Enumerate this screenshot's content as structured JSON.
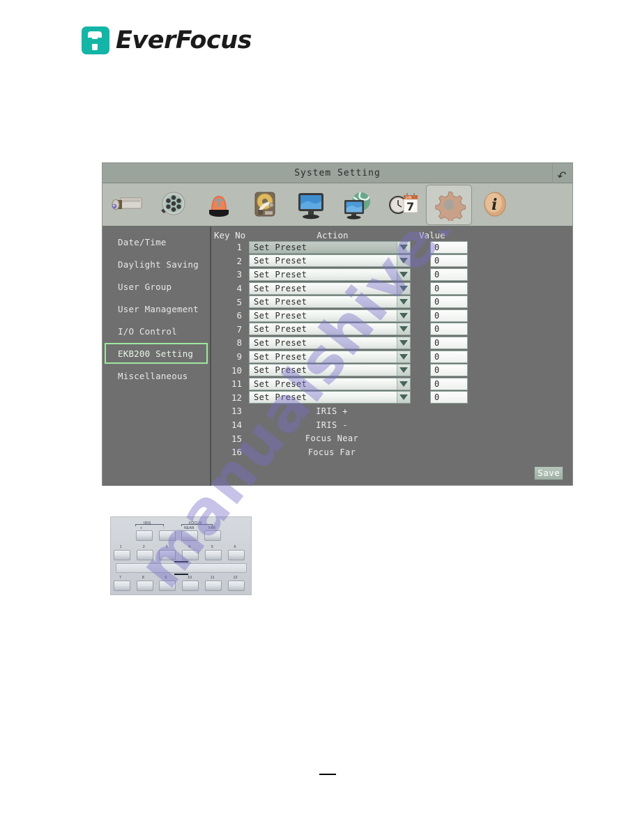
{
  "logo": {
    "brand": "EverFocus"
  },
  "watermark": {
    "text": "manualshive.com"
  },
  "osd": {
    "title": "System Setting",
    "back_icon": "back-arrow-icon",
    "toolbar": [
      {
        "name": "camera",
        "label": "Camera",
        "selected": false
      },
      {
        "name": "record",
        "label": "Record",
        "selected": false
      },
      {
        "name": "alarm",
        "label": "Alarm",
        "selected": false
      },
      {
        "name": "disk",
        "label": "Disk",
        "selected": false
      },
      {
        "name": "display",
        "label": "Display",
        "selected": false
      },
      {
        "name": "network",
        "label": "Network",
        "selected": false
      },
      {
        "name": "schedule",
        "label": "Schedule",
        "selected": false
      },
      {
        "name": "system",
        "label": "System",
        "selected": true
      },
      {
        "name": "information",
        "label": "Information",
        "selected": false
      }
    ],
    "sidebar": [
      {
        "label": "Date/Time",
        "selected": false
      },
      {
        "label": "Daylight Saving",
        "selected": false
      },
      {
        "label": "User Group",
        "selected": false
      },
      {
        "label": "User Management",
        "selected": false
      },
      {
        "label": "I/O Control",
        "selected": false
      },
      {
        "label": "EKB200 Setting",
        "selected": true
      },
      {
        "label": "Miscellaneous",
        "selected": false
      }
    ],
    "table": {
      "headers": {
        "key_no": "Key No",
        "action": "Action",
        "value": "Value"
      },
      "rows": [
        {
          "key": "1",
          "action": "Set Preset",
          "value": "0",
          "editable": true,
          "active": true
        },
        {
          "key": "2",
          "action": "Set Preset",
          "value": "0",
          "editable": true,
          "active": false
        },
        {
          "key": "3",
          "action": "Set Preset",
          "value": "0",
          "editable": true,
          "active": false
        },
        {
          "key": "4",
          "action": "Set Preset",
          "value": "0",
          "editable": true,
          "active": false
        },
        {
          "key": "5",
          "action": "Set Preset",
          "value": "0",
          "editable": true,
          "active": false
        },
        {
          "key": "6",
          "action": "Set Preset",
          "value": "0",
          "editable": true,
          "active": false
        },
        {
          "key": "7",
          "action": "Set Preset",
          "value": "0",
          "editable": true,
          "active": false
        },
        {
          "key": "8",
          "action": "Set Preset",
          "value": "0",
          "editable": true,
          "active": false
        },
        {
          "key": "9",
          "action": "Set Preset",
          "value": "0",
          "editable": true,
          "active": false
        },
        {
          "key": "10",
          "action": "Set Preset",
          "value": "0",
          "editable": true,
          "active": false
        },
        {
          "key": "11",
          "action": "Set Preset",
          "value": "0",
          "editable": true,
          "active": false
        },
        {
          "key": "12",
          "action": "Set Preset",
          "value": "0",
          "editable": true,
          "active": false
        },
        {
          "key": "13",
          "action": "IRIS +",
          "value": "",
          "editable": false,
          "active": false
        },
        {
          "key": "14",
          "action": "IRIS -",
          "value": "",
          "editable": false,
          "active": false
        },
        {
          "key": "15",
          "action": "Focus Near",
          "value": "",
          "editable": false,
          "active": false
        },
        {
          "key": "16",
          "action": "Focus Far",
          "value": "",
          "editable": false,
          "active": false
        }
      ]
    },
    "save_label": "Save"
  },
  "keypad": {
    "group_iris": "IRIS",
    "group_focus": "FOCUS",
    "iris_plus": "+",
    "iris_minus": "-",
    "focus_near": "NEAR",
    "focus_far": "FAR",
    "numbers_top": [
      "1",
      "2",
      "3",
      "4",
      "5",
      "6"
    ],
    "numbers_bottom": [
      "7",
      "8",
      "9",
      "10",
      "11",
      "12"
    ]
  },
  "colors": {
    "panel_bg": "#6f6f6f",
    "titlebar": "#9aa49d",
    "toolbar": "#b8bdb5",
    "selection_green": "#9de8a0",
    "brand_teal": "#13b5a6"
  }
}
